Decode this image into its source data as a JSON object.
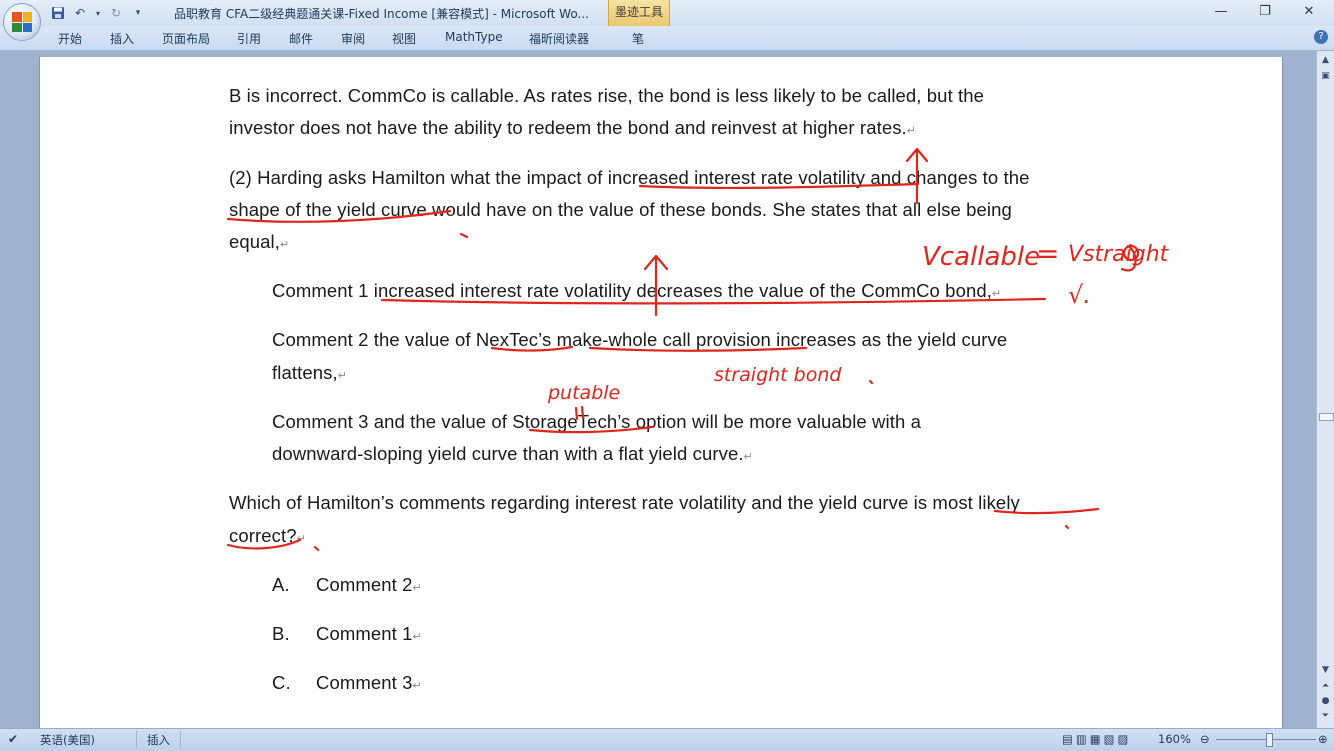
{
  "window": {
    "title": "品职教育 CFA二级经典题通关课-Fixed Income [兼容模式] - Microsoft Wo...",
    "contextual_tab": "墨迹工具",
    "controls": {
      "minimize": "—",
      "restore": "❐",
      "close": "✕"
    }
  },
  "ribbon": {
    "tabs": [
      "开始",
      "插入",
      "页面布局",
      "引用",
      "邮件",
      "审阅",
      "视图",
      "MathType",
      "福昕阅读器",
      "笔"
    ],
    "help": "?"
  },
  "document": {
    "lines": [
      {
        "text": "B is incorrect. CommCo is callable. As rates rise, the bond is less likely to be called, but the",
        "mark": ""
      },
      {
        "text": "investor does not have the ability to redeem the bond and reinvest at higher rates.",
        "mark": "↵"
      },
      {
        "text": "(2) Harding asks Hamilton what the impact of increased interest rate volatility and changes to the",
        "mark": ""
      },
      {
        "text": "shape of the yield curve would have on the value of these bonds. She states that all else being",
        "mark": ""
      },
      {
        "text": "equal,",
        "mark": "↵"
      },
      {
        "text": "Comment 1 increased interest rate volatility decreases the value of the CommCo bond,",
        "mark": "↵"
      },
      {
        "text": "Comment 2 the value of NexTec’s make-whole call provision increases as the yield curve",
        "mark": ""
      },
      {
        "text": "flattens,",
        "mark": "↵"
      },
      {
        "text": "Comment 3 and the value of StorageTech’s option will be more valuable with a",
        "mark": ""
      },
      {
        "text": "downward-sloping yield curve than with a flat yield curve.",
        "mark": "↵"
      },
      {
        "text": "Which of Hamilton’s comments regarding interest rate volatility and the yield curve is most likely",
        "mark": ""
      },
      {
        "text": "correct?",
        "mark": "↵"
      },
      {
        "text": "A.",
        "mark": ""
      },
      {
        "text": "Comment 2",
        "mark": "↵"
      },
      {
        "text": "B.",
        "mark": ""
      },
      {
        "text": "Comment 1",
        "mark": "↵"
      },
      {
        "text": "C.",
        "mark": ""
      },
      {
        "text": "Comment 3",
        "mark": "↵"
      }
    ]
  },
  "ink_notes": {
    "formula_left": "Vcallable",
    "formula_eq": "=",
    "formula_right": "Vstraight",
    "check": "√.",
    "straight_bond": "straight bond",
    "putable": "putable"
  },
  "statusbar": {
    "language": "英语(美国)",
    "mode": "插入",
    "zoom": "160%"
  },
  "colors": {
    "ink": "#e0261c",
    "accent": "#2b579a"
  }
}
